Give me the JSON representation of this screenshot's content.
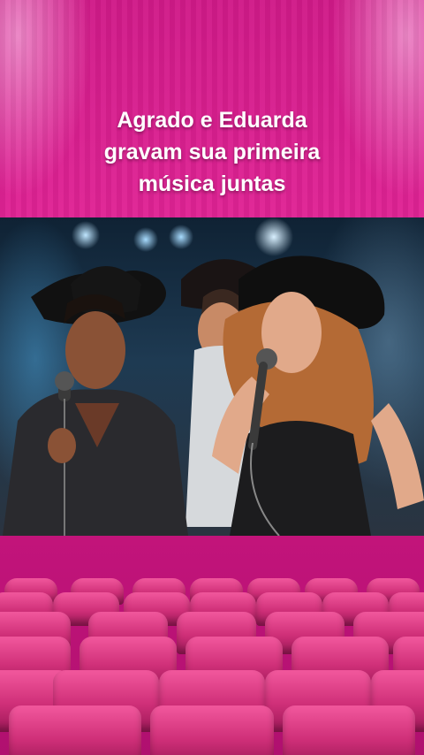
{
  "caption": {
    "line1": "Agrado e Eduarda",
    "line2": "gravam sua primeira",
    "line3": "música juntas"
  },
  "colors": {
    "background": "#d01a88",
    "seat": "#e0448a",
    "caption_text": "#ffffff"
  }
}
